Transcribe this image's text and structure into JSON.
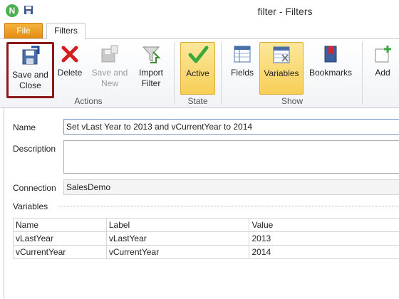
{
  "window": {
    "title": "filter - Filters",
    "app_icon_letter": "N"
  },
  "tabs": {
    "file": "File",
    "filters": "Filters"
  },
  "ribbon": {
    "save_close": "Save and\nClose",
    "delete": "Delete",
    "save_new": "Save and\nNew",
    "import_filter": "Import\nFilter",
    "active": "Active",
    "fields": "Fields",
    "variables": "Variables",
    "bookmarks": "Bookmarks",
    "add": "Add",
    "group_actions": "Actions",
    "group_state": "State",
    "group_show": "Show"
  },
  "form": {
    "name_label": "Name",
    "name_value": "Set vLast Year to 2013 and vCurrentYear to 2014",
    "description_label": "Description",
    "description_value": "",
    "connection_label": "Connection",
    "connection_value": "SalesDemo",
    "variables_label": "Variables"
  },
  "grid": {
    "headers": [
      "Name",
      "Label",
      "Value"
    ],
    "rows": [
      [
        "vLastYear",
        "vLastYear",
        "2013"
      ],
      [
        "vCurrentYear",
        "vCurrentYear",
        "2014"
      ]
    ]
  },
  "colors": {
    "accent_file_tab": "#e8931a",
    "active_state": "#f7cf57",
    "highlight_border": "#8b1a1a"
  }
}
